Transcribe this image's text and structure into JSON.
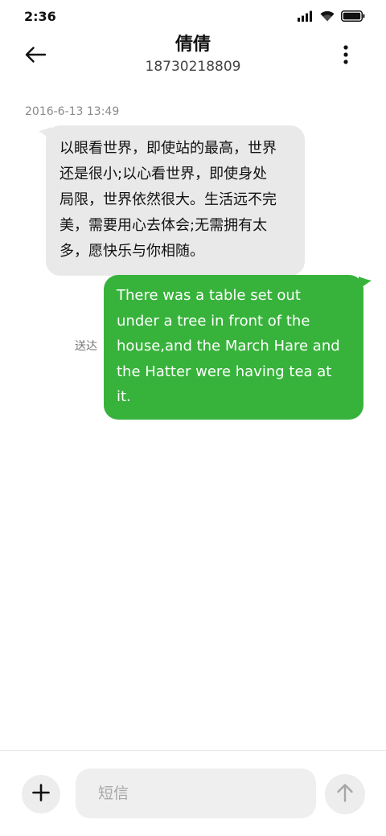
{
  "status_bar": {
    "time": "2:36",
    "icons": [
      "signal-icon",
      "wifi-icon",
      "battery-icon"
    ]
  },
  "header": {
    "contact_name": "倩倩",
    "contact_number": "18730218809",
    "back_icon": "arrow-left-icon",
    "more_icon": "more-vertical-icon"
  },
  "conversation": {
    "timestamp": "2016-6-13 13:49",
    "messages": [
      {
        "direction": "incoming",
        "lines": [
          "以眼看世界，即使站的最高，世界",
          "还是很小;以心看世界，即使身处",
          "局限，世界依然很大。生活远不完",
          "美，需要用心去体会;无需拥有太",
          "多，愿快乐与你相随。"
        ]
      },
      {
        "direction": "outgoing",
        "lines": [
          "There was a table set out",
          "under a tree in front of the",
          "house,and the March Hare and",
          "the Hatter were having tea at",
          "it."
        ],
        "status": "送达"
      }
    ]
  },
  "composer": {
    "placeholder": "短信",
    "add_icon": "plus-icon",
    "send_icon": "arrow-up-icon"
  },
  "colors": {
    "outgoing_bubble": "#37b33b",
    "incoming_bubble": "#e9e9e9",
    "timestamp_text": "#8a8a8a"
  }
}
